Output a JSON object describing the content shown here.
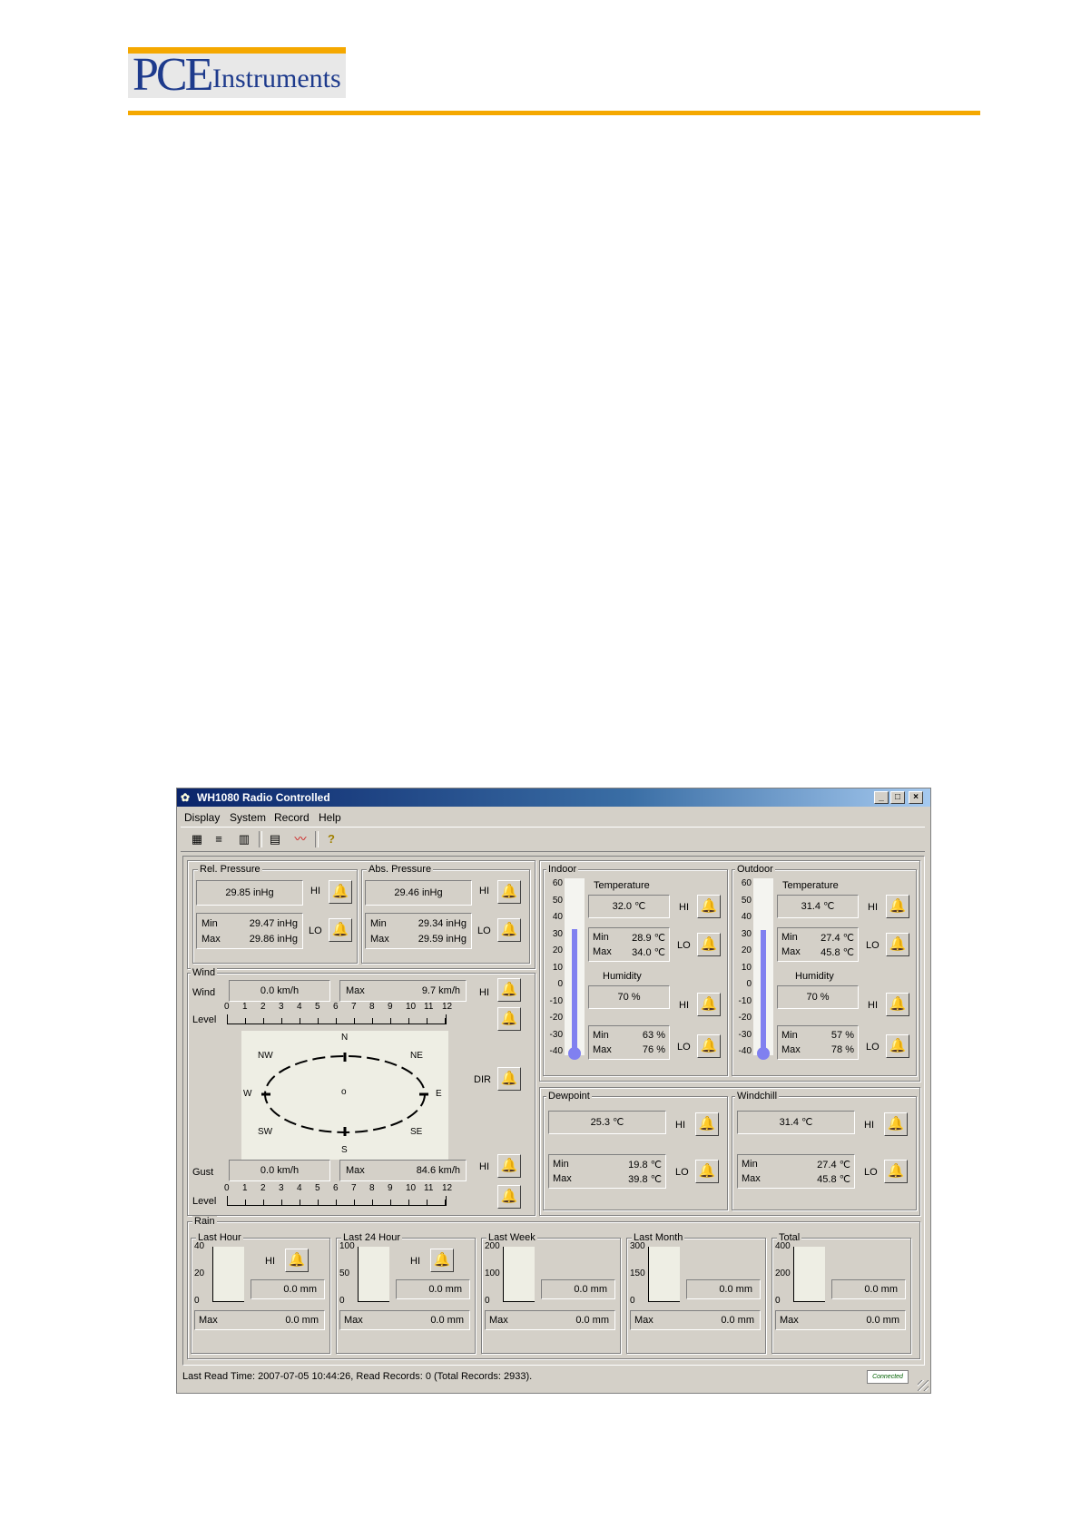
{
  "document": {
    "logo_text_pce": "PCE",
    "logo_text_instruments": "Instruments",
    "brand_colors": {
      "orange": "#f5a800",
      "blue": "#1d3a8c"
    }
  },
  "window": {
    "title": "WH1080 Radio Controlled",
    "caption_buttons": [
      "_",
      "□",
      "×"
    ],
    "menu": [
      "Display",
      "System",
      "Record",
      "Help"
    ],
    "toolbar_icons": [
      "display-icon",
      "system-icon",
      "record-icon",
      "calendar-icon",
      "graph-icon",
      "help-icon"
    ],
    "pressure": {
      "rel_label": "Rel. Pressure",
      "rel_value": "29.85 inHg",
      "rel_min": "29.47 inHg",
      "rel_max": "29.86 inHg",
      "abs_label": "Abs. Pressure",
      "abs_value": "29.46 inHg",
      "abs_min": "29.34 inHg",
      "abs_max": "29.59 inHg"
    },
    "labels": {
      "hi": "HI",
      "lo": "LO",
      "min": "Min",
      "max": "Max",
      "dir": "DIR",
      "level": "Level",
      "temperature": "Temperature",
      "humidity": "Humidity"
    },
    "wind": {
      "group_label": "Wind",
      "wind_label": "Wind",
      "wind_value": "0.0 km/h",
      "wind_max": "9.7 km/h",
      "gust_label": "Gust",
      "gust_value": "0.0 km/h",
      "gust_max": "84.6 km/h",
      "scale": [
        "0",
        "1",
        "2",
        "3",
        "4",
        "5",
        "6",
        "7",
        "8",
        "9",
        "10",
        "11",
        "12"
      ],
      "compass": {
        "N": "N",
        "NE": "NE",
        "E": "E",
        "SE": "SE",
        "S": "S",
        "SW": "SW",
        "W": "W",
        "NW": "NW",
        "center": "o"
      }
    },
    "indoor": {
      "group_label": "Indoor",
      "temperature": "32.0 ℃",
      "temp_min": "28.9 ℃",
      "temp_max": "34.0 ℃",
      "humidity": "70 %",
      "hum_min": "63 %",
      "hum_max": "76 %",
      "scale": [
        "60",
        "50",
        "40",
        "30",
        "20",
        "10",
        "0",
        "-10",
        "-20",
        "-30",
        "-40"
      ],
      "thermo_fill_fraction": 0.72
    },
    "outdoor": {
      "group_label": "Outdoor",
      "temperature": "31.4 ℃",
      "temp_min": "27.4 ℃",
      "temp_max": "45.8 ℃",
      "humidity": "70 %",
      "hum_min": "57 %",
      "hum_max": "78 %",
      "scale": [
        "60",
        "50",
        "40",
        "30",
        "20",
        "10",
        "0",
        "-10",
        "-20",
        "-30",
        "-40"
      ],
      "thermo_fill_fraction": 0.715
    },
    "dewpoint": {
      "group_label": "Dewpoint",
      "value": "25.3 ℃",
      "min": "19.8 ℃",
      "max": "39.8 ℃"
    },
    "windchill": {
      "group_label": "Windchill",
      "value": "31.4 ℃",
      "min": "27.4 ℃",
      "max": "45.8 ℃"
    },
    "rain": {
      "group_label": "Rain",
      "panels": [
        {
          "label": "Last Hour",
          "scale": [
            "40",
            "20",
            "0"
          ],
          "value": "0.0 mm",
          "max": "0.0 mm"
        },
        {
          "label": "Last 24 Hour",
          "scale": [
            "100",
            "50",
            "0"
          ],
          "value": "0.0 mm",
          "max": "0.0 mm"
        },
        {
          "label": "Last Week",
          "scale": [
            "200",
            "100",
            "0"
          ],
          "value": "0.0 mm",
          "max": "0.0 mm"
        },
        {
          "label": "Last Month",
          "scale": [
            "300",
            "150",
            "0"
          ],
          "value": "0.0 mm",
          "max": "0.0 mm"
        },
        {
          "label": "Total",
          "scale": [
            "400",
            "200",
            "0"
          ],
          "value": "0.0 mm",
          "max": "0.0 mm"
        }
      ]
    },
    "status": "Last Read Time: 2007-07-05 10:44:26, Read Records: 0 (Total Records: 2933).",
    "status_badge": "Connected"
  }
}
